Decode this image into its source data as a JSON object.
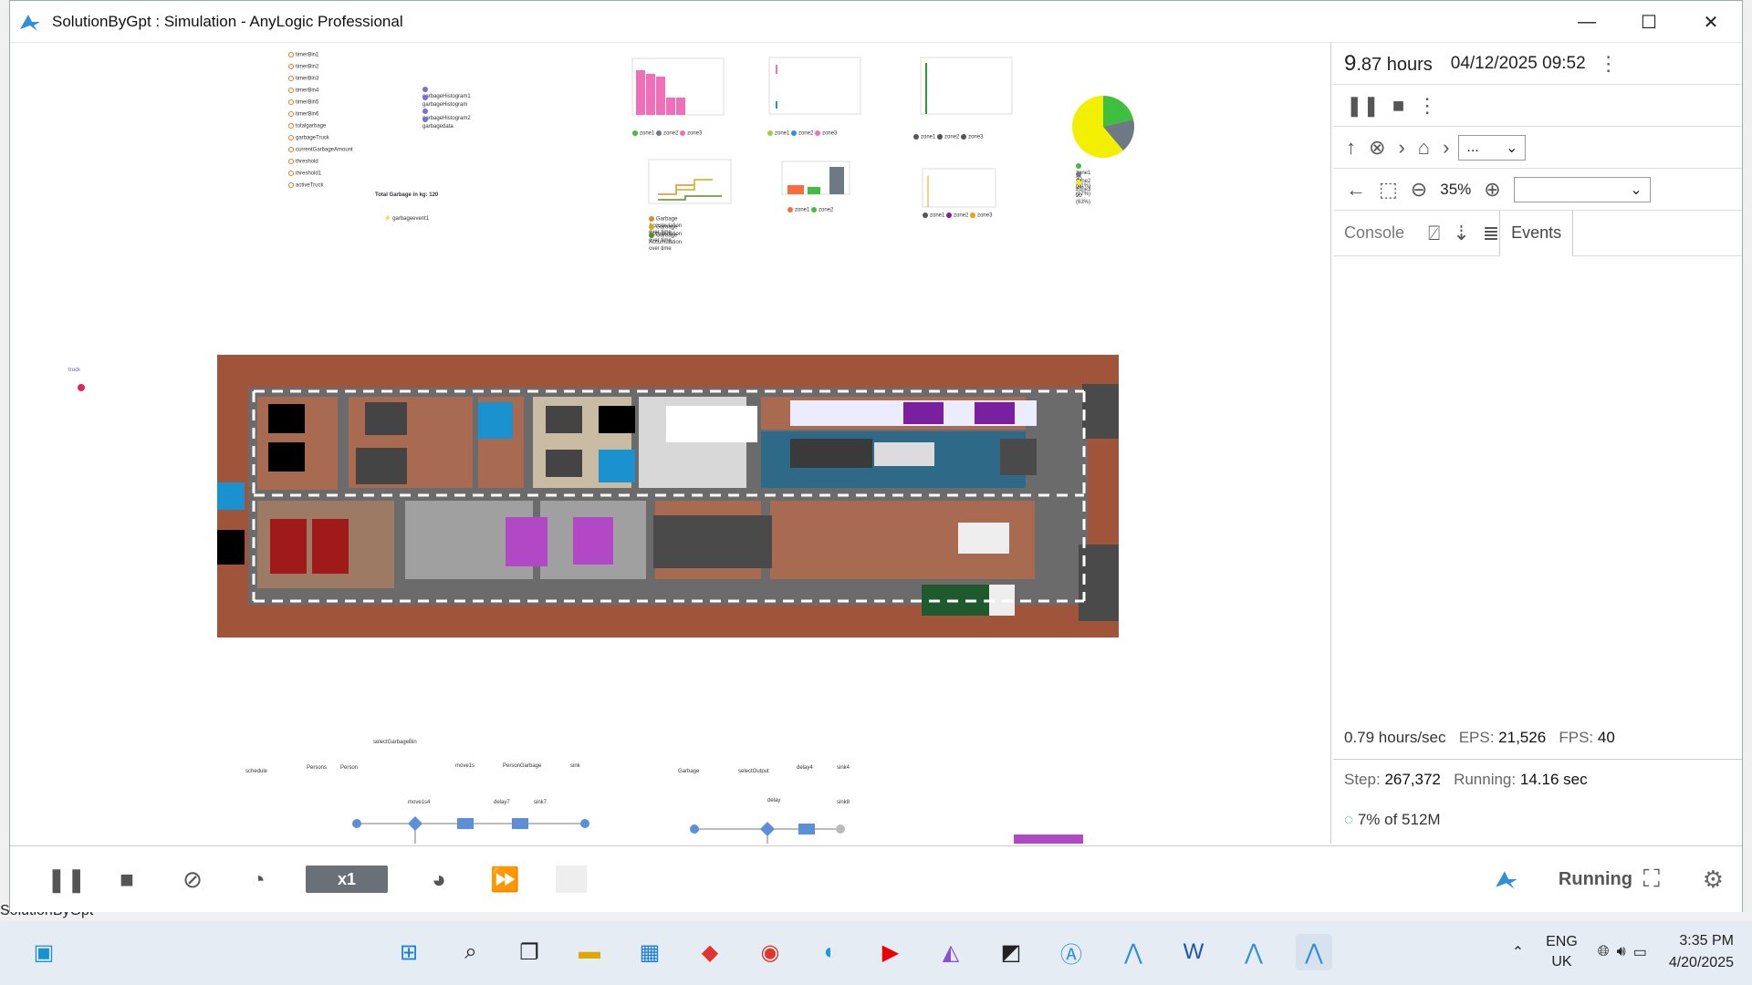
{
  "window": {
    "title": "SolutionByGpt : Simulation - AnyLogic Professional",
    "minimize": "—",
    "maximize": "☐",
    "close": "✕"
  },
  "canvas": {
    "params": [
      "timerBin1",
      "timerBin2",
      "timerBin3",
      "timerBin4",
      "timerBin5",
      "timerBin6",
      "totalgarbage",
      "garbageTruck",
      "currentGarbageAmount",
      "threshold",
      "threshold1",
      "activeTruck"
    ],
    "histograms": [
      "garbageHistogram1",
      "garbageHistogram",
      "garbageHistogram2",
      "garbagedata"
    ],
    "total_garbage": "Total Garbage in kg: 120",
    "event": "garbageevent1",
    "truck_label": "truck",
    "legend_zone1": "zone1",
    "legend_zone2": "zone2",
    "legend_zone3": "zone3",
    "legend_accum": "Garbage Accumulation over time",
    "pie_legend": [
      "zone1 30 (21%)",
      "zone2 24 (17%)",
      "zone3 90 (63%)"
    ],
    "flow_title": "selectGarbageBin",
    "flow_blocks": [
      "schedule",
      "Persons",
      "Person",
      "move1s",
      "PersonGarbage",
      "sink",
      "move1s4",
      "delay7",
      "sink7",
      "Garbage",
      "selectOutput",
      "delay4",
      "sink4",
      "delay",
      "sink8"
    ]
  },
  "panel": {
    "time_big": "9",
    "time_rest": ".87 hours",
    "datetime": "04/12/2025 09:52",
    "breadcrumb_value": "...",
    "zoom": "35%",
    "tabs": {
      "console": "Console",
      "events": "Events"
    },
    "stats": {
      "speed": "0.79 hours/sec",
      "eps_label": "EPS:",
      "eps": "21,526",
      "fps_label": "FPS:",
      "fps": "40",
      "step_label": "Step:",
      "step": "267,372",
      "running_label": "Running:",
      "running": "14.16 sec",
      "memory": "7% of 512M"
    }
  },
  "toolbar": {
    "speed": "x1",
    "status": "Running"
  },
  "taskbar": {
    "lang": "ENG",
    "region": "UK",
    "time": "3:35 PM",
    "date": "4/20/2025",
    "behind_text": "SolutionByGpt"
  },
  "colors": {
    "accent": "#2f8fd8",
    "brick": "#a0553a",
    "road": "#6b6b6b",
    "pie_green": "#3fbf3f",
    "pie_grey": "#6d7a86",
    "pie_yellow": "#f2f000",
    "bar_pink": "#f06fb8"
  }
}
